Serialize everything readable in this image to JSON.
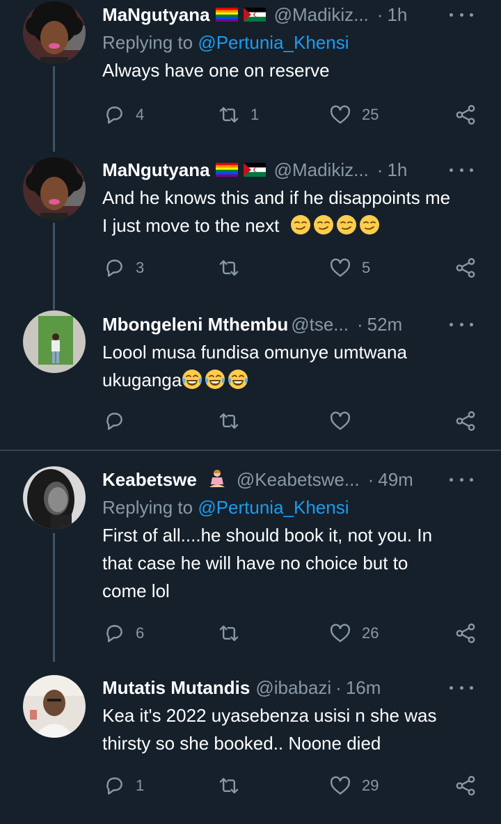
{
  "tweets": [
    {
      "name": "MaNgutyana",
      "handle": "@Madikiz...",
      "sep": "·",
      "time": "1h",
      "reply_prefix": "Replying to ",
      "reply_handle": "@Pertunia_Khensi",
      "text": "Always have one on reserve",
      "replies": "4",
      "retweets": "1",
      "likes": "25"
    },
    {
      "name": "MaNgutyana",
      "handle": "@Madikiz...",
      "sep": "·",
      "time": "1h",
      "text_line1": "And he knows this and if he disappoints me",
      "text_line2": "I just move to the next",
      "replies": "3",
      "retweets": "",
      "likes": "5"
    },
    {
      "name": "Mbongeleni Mthembu",
      "handle": "@tse...",
      "sep": "·",
      "time": "52m",
      "text_line1": "Loool musa fundisa omunye umtwana",
      "text_line2": "ukuganga",
      "replies": "",
      "retweets": "",
      "likes": ""
    },
    {
      "name": "Keabetswe",
      "handle": "@Keabetswe...",
      "sep": "·",
      "time": "49m",
      "reply_prefix": "Replying to ",
      "reply_handle": "@Pertunia_Khensi",
      "text_line1": "First of all....he should book it, not you. In",
      "text_line2": "that case he will have no choice but to",
      "text_line3": "come lol",
      "replies": "6",
      "retweets": "",
      "likes": "26"
    },
    {
      "name": "Mutatis Mutandis",
      "handle": "@ibabazi",
      "sep": "·",
      "time": "16m",
      "text_line1": "Kea it's 2022 uyasebenza usisi n she was",
      "text_line2": "thirsty so she booked.. Noone died",
      "replies": "1",
      "retweets": "",
      "likes": "29"
    }
  ],
  "colors": {
    "background": "#15202b",
    "secondary_text": "#8899a6",
    "link": "#1d9bf0",
    "divider": "#38444d"
  },
  "icons": {
    "reply": "reply-bubble-icon",
    "retweet": "retweet-icon",
    "like": "heart-icon",
    "share": "share-icon",
    "more": "more-dots-icon",
    "emoji_smirk": "smirking-face-emoji",
    "emoji_laugh": "tears-of-joy-emoji",
    "emoji_meditate": "person-in-lotus-position-emoji",
    "flag_rainbow": "rainbow-flag-emoji",
    "flag_sahrawi": "sahrawi-flag-emoji"
  }
}
